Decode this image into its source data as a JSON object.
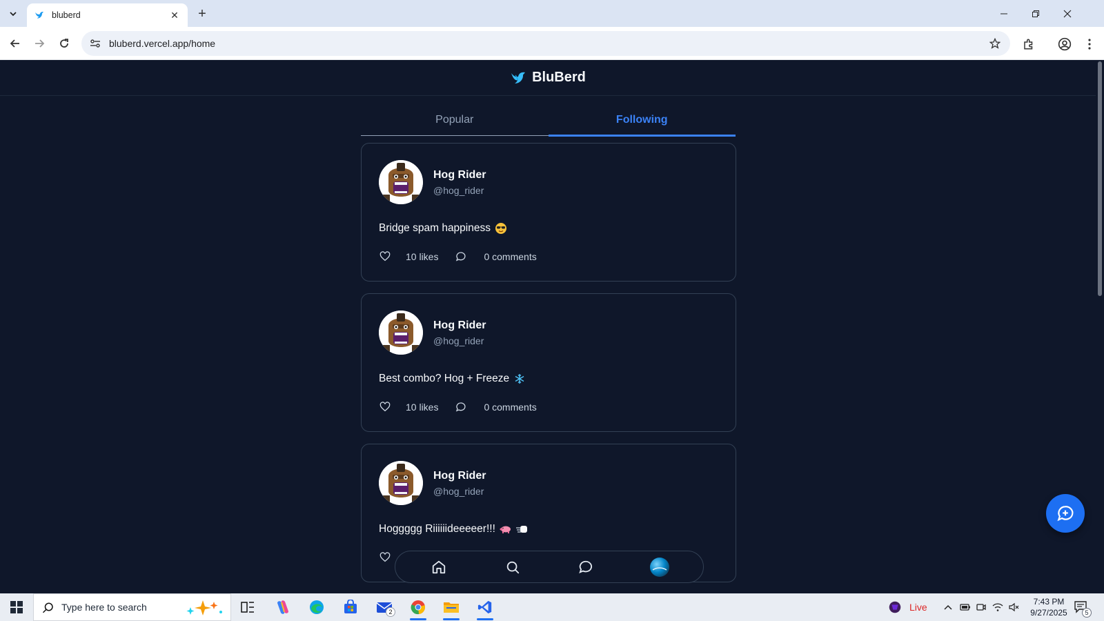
{
  "browser": {
    "tab_title": "bluberd",
    "url": "bluberd.vercel.app/home"
  },
  "app": {
    "brand": "BluBerd",
    "tabs": [
      {
        "label": "Popular",
        "active": false
      },
      {
        "label": "Following",
        "active": true
      }
    ],
    "accent_color": "#3b82f6",
    "posts": [
      {
        "name": "Hog Rider",
        "handle": "@hog_rider",
        "text": "Bridge spam happiness",
        "emoji": "sunglasses",
        "likes": "10 likes",
        "comments": "0 comments"
      },
      {
        "name": "Hog Rider",
        "handle": "@hog_rider",
        "text": "Best combo? Hog + Freeze",
        "emoji": "snowflake",
        "likes": "10 likes",
        "comments": "0 comments"
      },
      {
        "name": "Hog Rider",
        "handle": "@hog_rider",
        "text": "Hoggggg Riiiiiideeeeer!!!",
        "emoji": "pig-and-fist",
        "likes": "",
        "comments": ""
      }
    ],
    "bottom_nav": [
      "home-icon",
      "search-icon",
      "chat-icon",
      "profile-avatar"
    ],
    "fab_icon": "new-post-icon"
  },
  "taskbar": {
    "search_placeholder": "Type here to search",
    "mail_badge": "2",
    "live_label": "Live",
    "time": "7:43 PM",
    "date": "9/27/2025",
    "notification_count": "5"
  }
}
